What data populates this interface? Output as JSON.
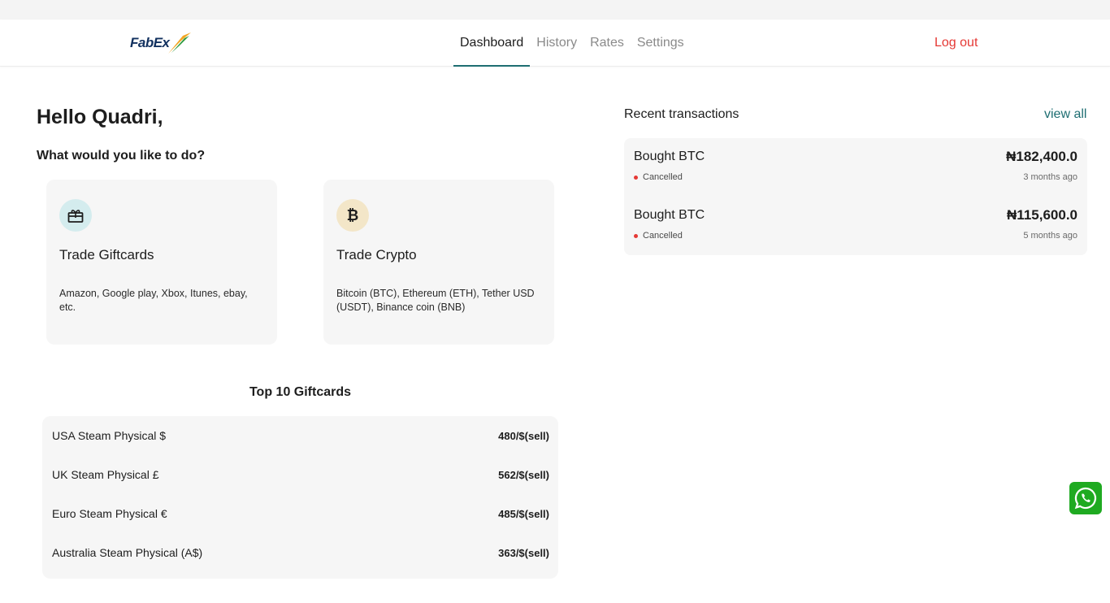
{
  "brand": {
    "logo_text": "FabEx"
  },
  "nav": {
    "items": [
      {
        "label": "Dashboard",
        "active": true
      },
      {
        "label": "History",
        "active": false
      },
      {
        "label": "Rates",
        "active": false
      },
      {
        "label": "Settings",
        "active": false
      }
    ],
    "logout_label": "Log out"
  },
  "main": {
    "greeting": "Hello Quadri,",
    "prompt": "What would you like to do?",
    "cards": [
      {
        "icon": "gift-icon",
        "title": "Trade Giftcards",
        "description": "Amazon, Google play, Xbox, Itunes, ebay, etc."
      },
      {
        "icon": "bitcoin-icon",
        "title": "Trade Crypto",
        "description": "Bitcoin (BTC), Ethereum (ETH), Tether USD (USDT), Binance coin (BNB)"
      }
    ],
    "top_giftcards_title": "Top 10 Giftcards",
    "giftcards": [
      {
        "name": "USA Steam Physical $",
        "rate": "480/$(sell)"
      },
      {
        "name": "UK Steam Physical £",
        "rate": "562/$(sell)"
      },
      {
        "name": "Euro Steam Physical €",
        "rate": "485/$(sell)"
      },
      {
        "name": "Australia Steam Physical (A$)",
        "rate": "363/$(sell)"
      }
    ]
  },
  "recent": {
    "title": "Recent transactions",
    "view_all_label": "view all",
    "transactions": [
      {
        "title": "Bought BTC",
        "status": "Cancelled",
        "amount": "₦182,400.0",
        "time": "3 months ago"
      },
      {
        "title": "Bought BTC",
        "status": "Cancelled",
        "amount": "₦115,600.0",
        "time": "5 months ago"
      }
    ]
  },
  "colors": {
    "accent": "#1e6e72",
    "danger": "#e53935",
    "gift_icon_bg": "#d4ecee",
    "crypto_icon_bg": "#f3e6c8",
    "whatsapp": "#1faa21"
  },
  "floating": {
    "icon": "whatsapp-icon"
  }
}
